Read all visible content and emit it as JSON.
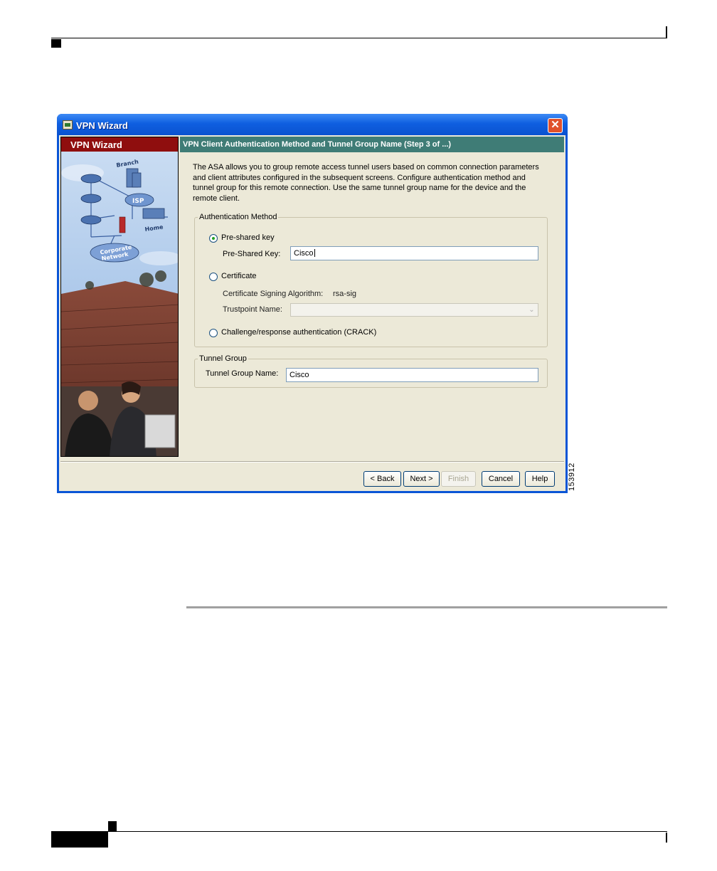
{
  "figure_id": "153912",
  "window": {
    "title": "VPN Wizard",
    "close_label": "✕"
  },
  "left_panel": {
    "banner": "VPN Wizard",
    "diagram_labels": {
      "branch": "Branch",
      "isp": "ISP",
      "home": "Home",
      "corporate_network_line1": "Corporate",
      "corporate_network_line2": "Network"
    }
  },
  "header": {
    "title": "VPN Client Authentication Method and Tunnel Group Name  (Step 3 of ...)"
  },
  "description": "The ASA allows you to group remote access tunnel users based on common connection parameters and client attributes configured in the subsequent screens. Configure authentication method and tunnel group for this remote connection. Use the same tunnel group name for the device and the remote client.",
  "auth_method": {
    "legend": "Authentication Method",
    "preshared_radio_label": "Pre-shared key",
    "preshared_selected": true,
    "preshared_key_label": "Pre-Shared Key:",
    "preshared_key_value": "Cisco",
    "certificate_radio_label": "Certificate",
    "signing_algorithm_label": "Certificate Signing Algorithm:",
    "signing_algorithm_value": "rsa-sig",
    "trustpoint_label": "Trustpoint Name:",
    "trustpoint_value": "",
    "crack_radio_label": "Challenge/response authentication (CRACK)"
  },
  "tunnel_group": {
    "legend": "Tunnel Group",
    "name_label": "Tunnel Group Name:",
    "name_value": "Cisco"
  },
  "buttons": {
    "back": "< Back",
    "next": "Next >",
    "finish": "Finish",
    "cancel": "Cancel",
    "help": "Help"
  },
  "colors": {
    "title_bar": "#0a55d6",
    "banner": "#8f0e0e",
    "header_bar": "#3f7c76",
    "dialog_background": "#ece9d8"
  }
}
